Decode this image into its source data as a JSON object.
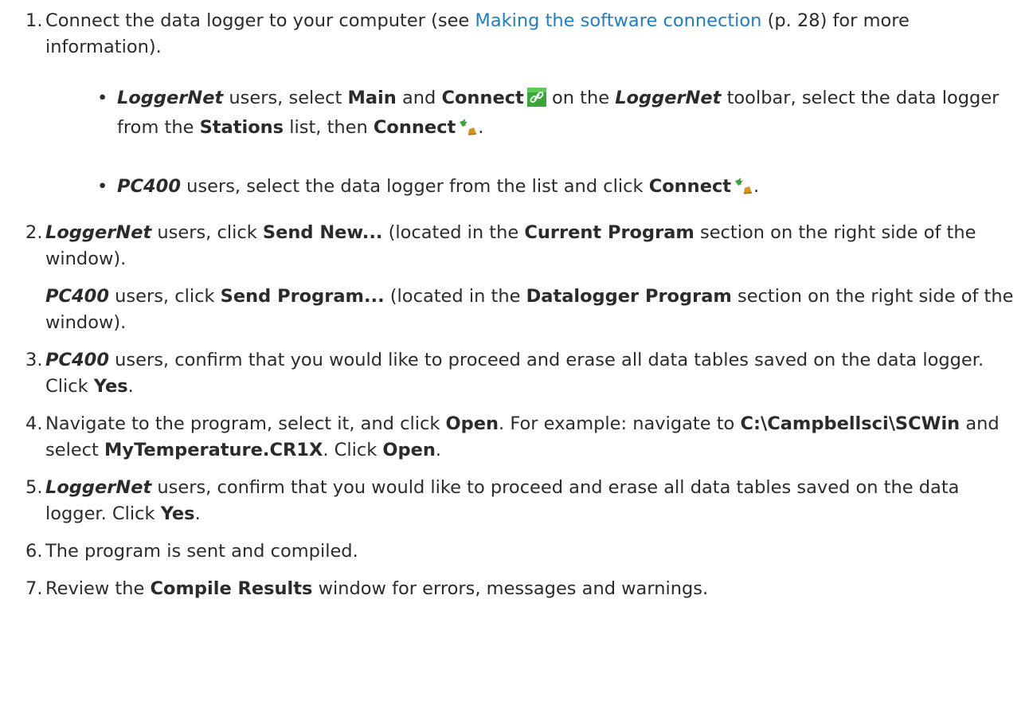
{
  "steps": {
    "s1": {
      "num": "1.",
      "t1": "Connect the data logger to your computer (see ",
      "link": "Making the software connection",
      "t2": " (p. 28) for more information).",
      "b1": {
        "p1": "LoggerNet",
        "t1": " users, select ",
        "k1": "Main",
        "t2": " and ",
        "k2": "Connect",
        "t3": " on the ",
        "p2": "LoggerNet",
        "t4": " toolbar, select the data logger from the ",
        "k3": "Stations",
        "t5": " list, then ",
        "k4": "Connect",
        "t6": "."
      },
      "b2": {
        "p1": "PC400",
        "t1": " users, select the data logger from the list and click ",
        "k1": "Connect",
        "t2": "."
      }
    },
    "s2": {
      "num": "2.",
      "p1": "LoggerNet",
      "t1": " users, click ",
      "k1": "Send New...",
      "t2": " (located in the ",
      "k2": "Current Program",
      "t3": " section on the right side of the window).",
      "q1": "PC400",
      "u1": " users, click ",
      "m1": "Send Program...",
      "u2": " (located in the ",
      "m2": "Datalogger Program",
      "u3": " section on the right side of the window)."
    },
    "s3": {
      "num": "3.",
      "p1": "PC400",
      "t1": " users, confirm that you would like to proceed and erase all data tables saved on the data logger. Click ",
      "k1": "Yes",
      "t2": "."
    },
    "s4": {
      "num": "4.",
      "t1": "Navigate to the program, select it, and click ",
      "k1": "Open",
      "t2": ". For example: navigate to ",
      "k2": "C:\\Campbellsci\\SCWin",
      "t3": " and select ",
      "k3": "MyTemperature.CR1X",
      "t4": ". Click ",
      "k4": "Open",
      "t5": "."
    },
    "s5": {
      "num": "5.",
      "p1": "LoggerNet",
      "t1": " users, confirm that you would like to proceed and erase all data tables saved on the data logger. Click ",
      "k1": "Yes",
      "t2": "."
    },
    "s6": {
      "num": "6.",
      "t1": "The program is sent and compiled."
    },
    "s7": {
      "num": "7.",
      "t1": "Review the ",
      "k1": "Compile Results",
      "t2": " window for errors, messages and warnings."
    }
  },
  "bullet_char": "•",
  "icons": {
    "toolbar_connect": "chain-link-icon",
    "connect": "plug-connector-icon"
  },
  "colors": {
    "text": "#2b2b2b",
    "link": "#1f7fc0",
    "icon_green": "#3aa63a",
    "icon_orange": "#d4961e"
  }
}
